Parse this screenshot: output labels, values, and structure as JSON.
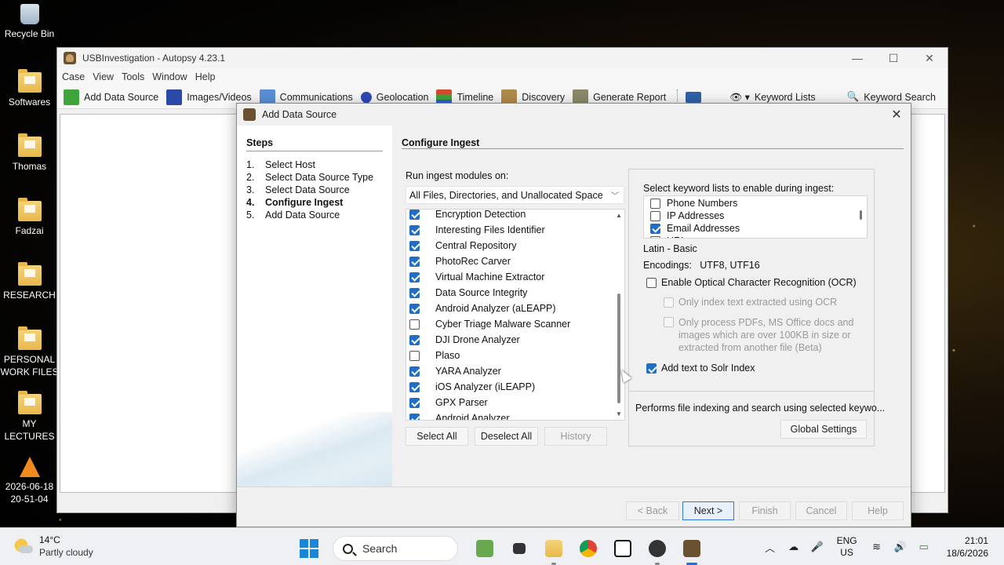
{
  "desktop": {
    "icons": [
      {
        "label": "Recycle Bin",
        "icon": "recycle-bin-icon"
      },
      {
        "label": "Softwares",
        "icon": "folder-icon"
      },
      {
        "label": "Thomas",
        "icon": "folder-icon"
      },
      {
        "label": "Fadzai",
        "icon": "folder-icon"
      },
      {
        "label": "RESEARCH",
        "icon": "folder-icon"
      },
      {
        "label": "PERSONAL WORK FILES",
        "icon": "folder-icon"
      },
      {
        "label": "MY LECTURES",
        "icon": "folder-icon"
      },
      {
        "label": "2026-06-18 20-51-04",
        "icon": "vlc-icon"
      }
    ]
  },
  "app": {
    "title": "USBInvestigation - Autopsy 4.23.1",
    "window_controls": {
      "minimize": "—",
      "maximize": "☐",
      "close": "✕"
    },
    "menu": [
      "Case",
      "View",
      "Tools",
      "Window",
      "Help"
    ],
    "toolbar": [
      {
        "label": "Add Data Source",
        "color": "#3fa43a"
      },
      {
        "label": "Images/Videos",
        "color": "#2b4aa8"
      },
      {
        "label": "Communications",
        "color": "#5a8fd6"
      },
      {
        "label": "Geolocation",
        "color": "#2e49b8"
      },
      {
        "label": "Timeline",
        "color": "#d8492f"
      },
      {
        "label": "Discovery",
        "color": "#b08a4a"
      },
      {
        "label": "Generate Report",
        "color": "#8a8a6a"
      }
    ],
    "toolbar_right": [
      "Keyword Lists",
      "Keyword Search"
    ]
  },
  "dialog": {
    "title": "Add Data Source",
    "close": "✕",
    "steps_heading": "Steps",
    "steps": [
      {
        "num": "1.",
        "label": "Select Host"
      },
      {
        "num": "2.",
        "label": "Select Data Source Type"
      },
      {
        "num": "3.",
        "label": "Select Data Source"
      },
      {
        "num": "4.",
        "label": "Configure Ingest"
      },
      {
        "num": "5.",
        "label": "Add Data Source"
      }
    ],
    "active_step": 4,
    "section_heading": "Configure Ingest",
    "run_label": "Run ingest modules on:",
    "run_selected": "All Files, Directories, and Unallocated Space",
    "modules": [
      {
        "label": "Encryption Detection",
        "checked": true
      },
      {
        "label": "Interesting Files Identifier",
        "checked": true
      },
      {
        "label": "Central Repository",
        "checked": true
      },
      {
        "label": "PhotoRec Carver",
        "checked": true
      },
      {
        "label": "Virtual Machine Extractor",
        "checked": true
      },
      {
        "label": "Data Source Integrity",
        "checked": true
      },
      {
        "label": "Android Analyzer (aLEAPP)",
        "checked": true
      },
      {
        "label": "Cyber Triage Malware Scanner",
        "checked": false
      },
      {
        "label": "DJI Drone Analyzer",
        "checked": true
      },
      {
        "label": "Plaso",
        "checked": false
      },
      {
        "label": "YARA Analyzer",
        "checked": true
      },
      {
        "label": "iOS Analyzer (iLEAPP)",
        "checked": true
      },
      {
        "label": "GPX Parser",
        "checked": true
      },
      {
        "label": "Android Analyzer",
        "checked": true
      }
    ],
    "buttons": {
      "select_all": "Select All",
      "deselect_all": "Deselect All",
      "history": "History"
    },
    "keyword": {
      "label": "Select keyword lists to enable during ingest:",
      "lists": [
        {
          "label": "Phone Numbers",
          "checked": false
        },
        {
          "label": "IP Addresses",
          "checked": false
        },
        {
          "label": "Email Addresses",
          "checked": true
        },
        {
          "label": "URLs",
          "checked": false
        }
      ],
      "script": "Latin - Basic",
      "encodings_label": "Encodings:",
      "encodings": "UTF8, UTF16",
      "ocr_label": "Enable Optical Character Recognition (OCR)",
      "ocr_checked": false,
      "ocr_only_index": "Only index text extracted using OCR",
      "ocr_only_process": "Only process PDFs, MS Office docs and images which are over 100KB in size or extracted from another file (Beta)",
      "solr_label": "Add text to Solr Index",
      "solr_checked": true,
      "description": "Performs file indexing and search using selected keywo...",
      "global_settings": "Global Settings"
    },
    "nav": {
      "back": "< Back",
      "next": "Next >",
      "finish": "Finish",
      "cancel": "Cancel",
      "help": "Help"
    }
  },
  "taskbar": {
    "weather_temp": "14°C",
    "weather_desc": "Partly cloudy",
    "search_placeholder": "Search",
    "lang_line1": "ENG",
    "lang_line2": "US",
    "time": "21:01",
    "date": "18/6/2026"
  }
}
